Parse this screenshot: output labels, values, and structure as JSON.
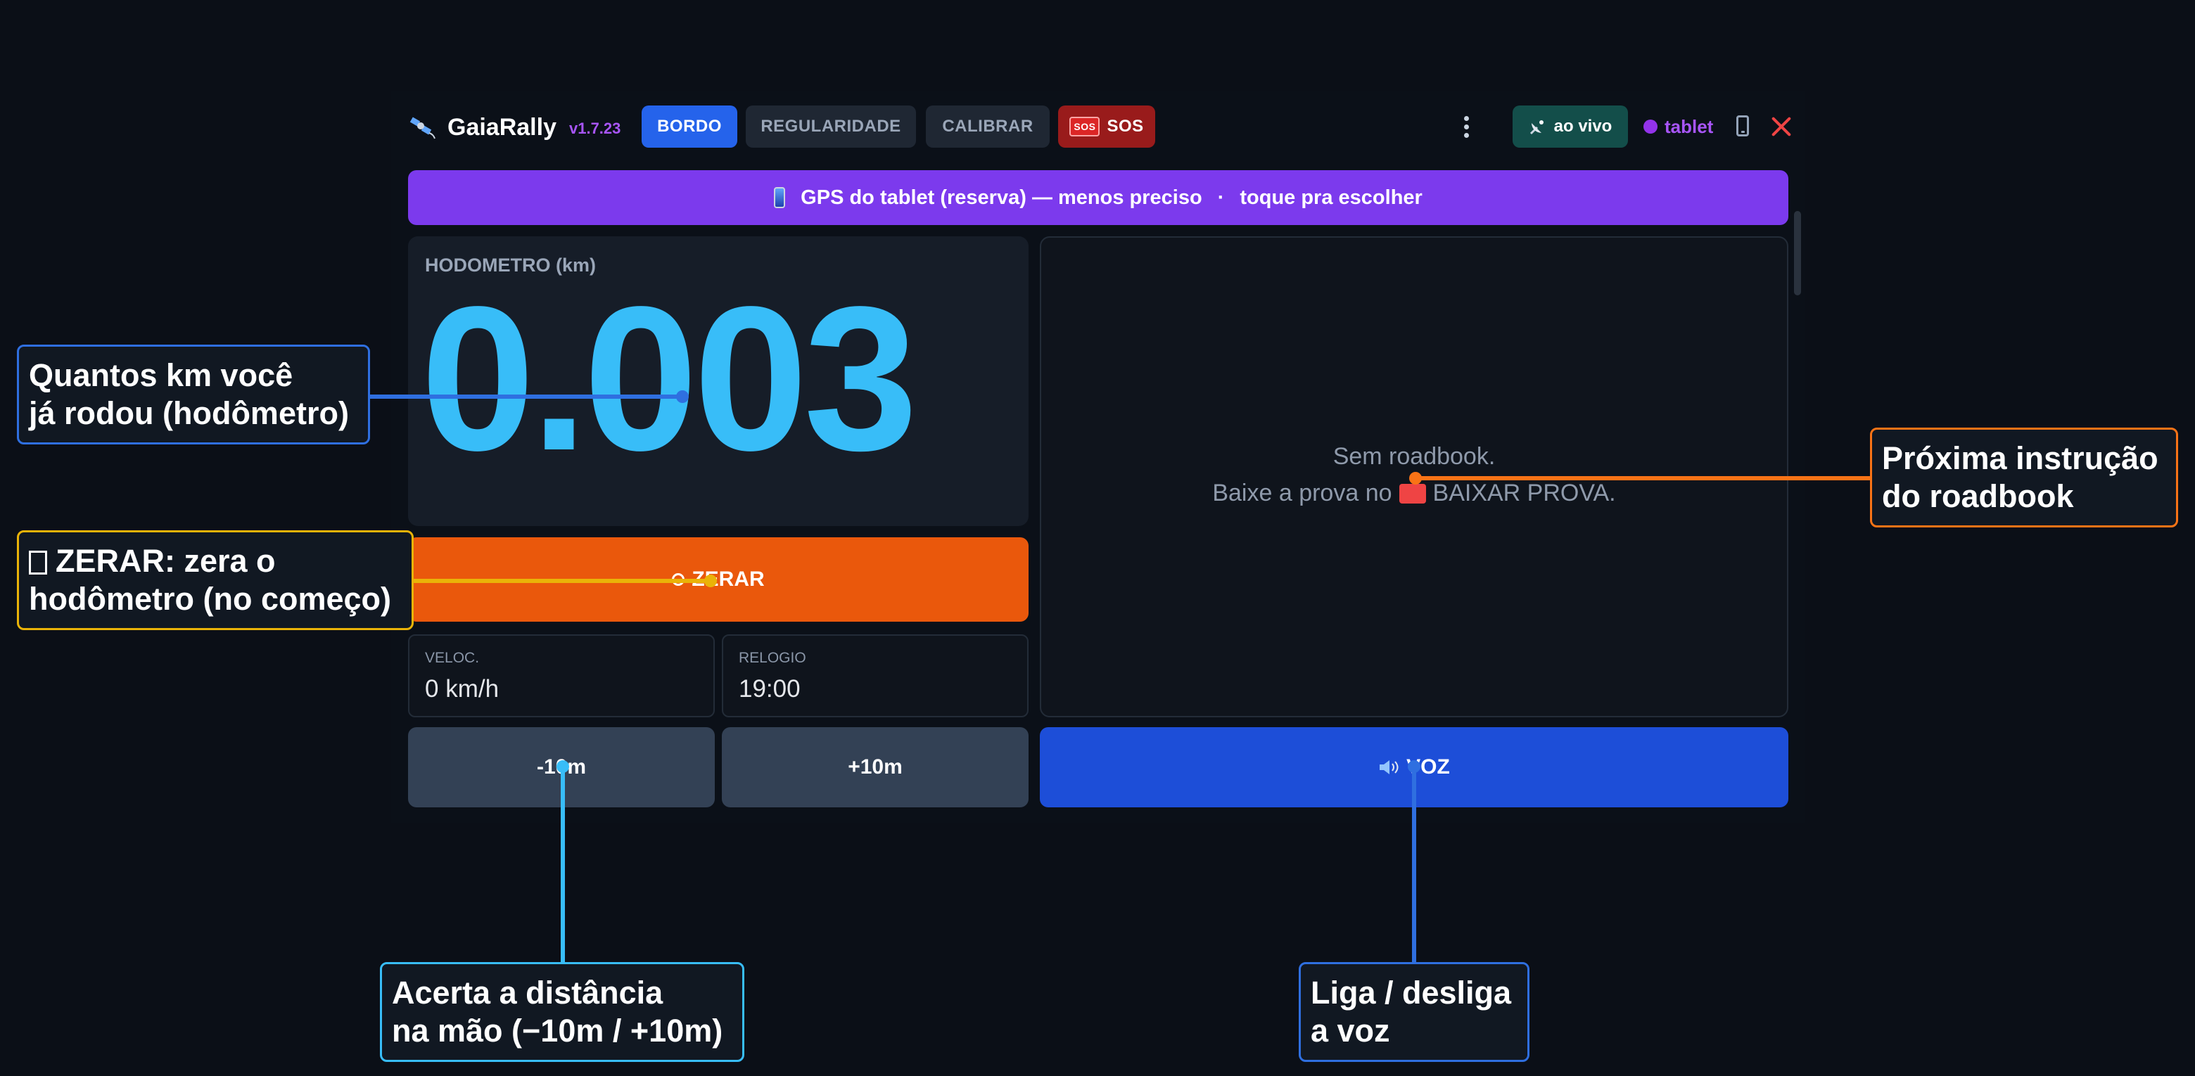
{
  "app": {
    "name": "GaiaRally",
    "version": "v1.7.23"
  },
  "tabs": [
    {
      "label": "BORDO",
      "active": true
    },
    {
      "label": "REGULARIDADE",
      "active": false
    },
    {
      "label": "CALIBRAR",
      "active": false
    },
    {
      "label": "SOS",
      "badge": "SOS",
      "active": false
    }
  ],
  "header": {
    "live_label": "ao vivo",
    "device_label": "tablet"
  },
  "banner": {
    "text": "GPS do tablet (reserva) — menos preciso",
    "separator": "·",
    "action": "toque pra escolher"
  },
  "odometer": {
    "label": "HODOMETRO (km)",
    "value": "0.003"
  },
  "reset_button": {
    "label": "ZERAR"
  },
  "stats": {
    "speed": {
      "label": "VELOC.",
      "value": "0 km/h"
    },
    "clock": {
      "label": "RELOGIO",
      "value": "19:00"
    }
  },
  "adjust": {
    "minus_label": "-10m",
    "plus_label": "+10m"
  },
  "roadbook": {
    "line1": "Sem roadbook.",
    "line2_prefix": "Baixe a prova no",
    "line2_action": "BAIXAR PROVA."
  },
  "voice_button": {
    "label": "VOZ"
  },
  "annotations": {
    "odometer": "Quantos km você\njá rodou (hodômetro)",
    "reset": "ZERAR: zera o\nhodômetro (no começo)",
    "roadbook": "Próxima instrução\ndo roadbook",
    "adjust": "Acerta a distância\nna mão (−10m / +10m)",
    "voice": "Liga / desliga\na voz"
  },
  "colors": {
    "accent_blue": "#2563eb",
    "odometer_cyan": "#38bdf8",
    "reset_orange": "#ea580c",
    "banner_purple": "#7c3aed",
    "sos_red": "#991b1b",
    "live_teal": "#134e4a",
    "note_blue": "#2f6fe0",
    "note_yellow": "#eab308",
    "note_orange": "#f97316",
    "note_cyan": "#38bdf8"
  }
}
